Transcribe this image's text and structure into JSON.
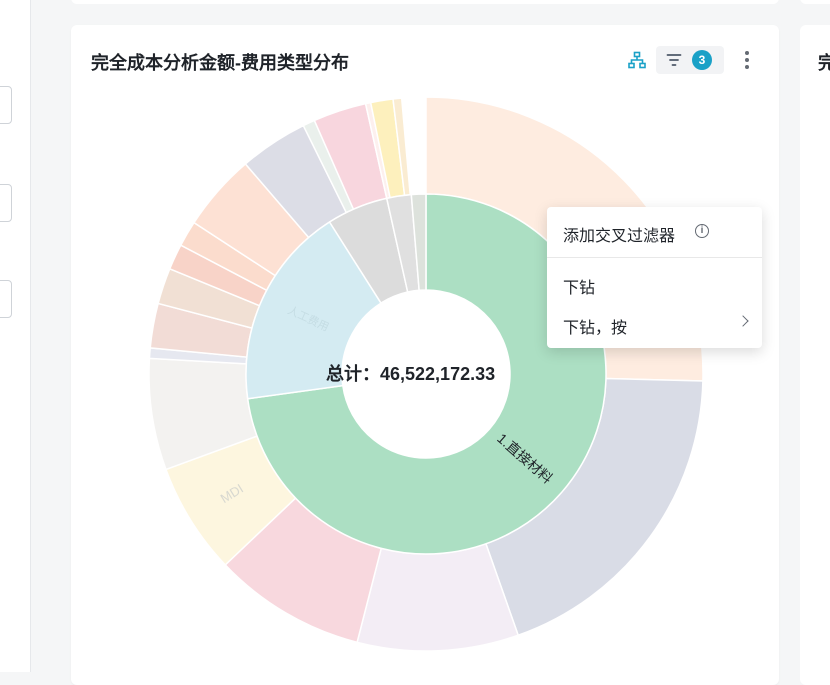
{
  "card": {
    "title": "完全成本分析金额-费用类型分布",
    "filter_count": "3",
    "next_card_title": "完"
  },
  "chart_data": {
    "type": "sunburst",
    "total_label": "总计：46,522,172.33",
    "total": 46522172.33,
    "inner_ring": [
      {
        "label": "1.直接材料",
        "share": 0.728,
        "color": "#acdfc3"
      },
      {
        "label": "人工费用",
        "share": 0.182,
        "color": "#d4ebf2"
      },
      {
        "label": "",
        "share": 0.055,
        "color": "#dcdcdc"
      },
      {
        "label": "",
        "share": 0.022,
        "color": "#e0e0e0"
      },
      {
        "label": "",
        "share": 0.013,
        "color": "#dde2dc"
      }
    ],
    "outer_ring": [
      {
        "label": "",
        "share": 0.254,
        "color": "#feece0"
      },
      {
        "label": "",
        "share": 0.192,
        "color": "#d9dce6"
      },
      {
        "label": "",
        "share": 0.094,
        "color": "#f3edf5"
      },
      {
        "label": "",
        "share": 0.089,
        "color": "#f8d8de"
      },
      {
        "label": "MDI",
        "share": 0.065,
        "color": "#fdf6df"
      },
      {
        "label": "",
        "share": 0.065,
        "color": "#f3f2f0"
      },
      {
        "label": "",
        "share": 0.006,
        "color": "#e6e8f0"
      },
      {
        "label": "",
        "share": 0.026,
        "color": "#f2dcd6"
      },
      {
        "label": "",
        "share": 0.021,
        "color": "#f1e0d4"
      },
      {
        "label": "",
        "share": 0.015,
        "color": "#f8d3c8"
      },
      {
        "label": "",
        "share": 0.015,
        "color": "#fbdccd"
      },
      {
        "label": "",
        "share": 0.045,
        "color": "#fde1d4"
      },
      {
        "label": "",
        "share": 0.04,
        "color": "#dcdde6"
      },
      {
        "label": "",
        "share": 0.007,
        "color": "#eaf0ec"
      },
      {
        "label": "",
        "share": 0.031,
        "color": "#f8d6de"
      },
      {
        "label": "",
        "share": 0.003,
        "color": "#fdf0ee"
      },
      {
        "label": "",
        "share": 0.013,
        "color": "#fdf0bd"
      },
      {
        "label": "",
        "share": 0.005,
        "color": "#faecd2"
      }
    ]
  },
  "context_menu": {
    "items": [
      "添加交叉过滤器",
      "下钻",
      "下钻，按"
    ]
  },
  "icons": {
    "hierarchy": "hierarchy-icon",
    "filter": "filter-icon",
    "more": "more-vertical-icon",
    "info": "info-icon",
    "chevron": "chevron-right-icon"
  },
  "colors": {
    "accent": "#1aa1c7",
    "highlight": "#acdfc3"
  }
}
